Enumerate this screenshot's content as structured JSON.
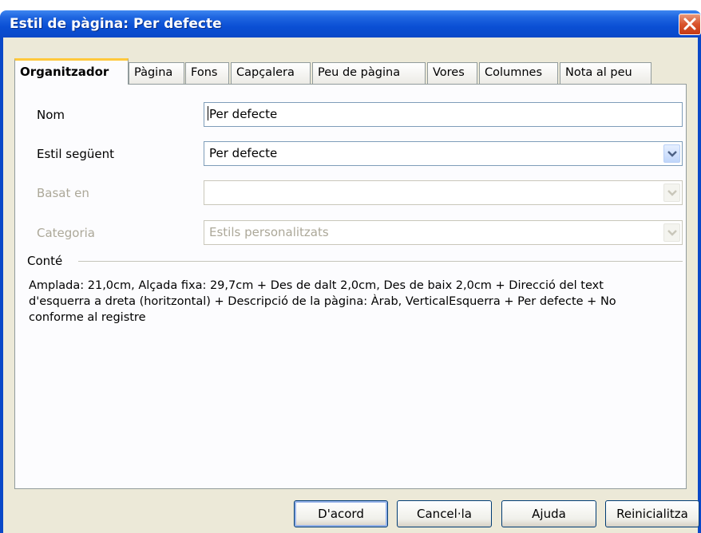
{
  "window": {
    "title": "Estil de pàgina: Per defecte"
  },
  "tabs": [
    {
      "label": "Organitzador"
    },
    {
      "label": "Pàgina"
    },
    {
      "label": "Fons"
    },
    {
      "label": "Capçalera"
    },
    {
      "label": "Peu de pàgina"
    },
    {
      "label": "Vores"
    },
    {
      "label": "Columnes"
    },
    {
      "label": "Nota al peu"
    }
  ],
  "form": {
    "name_label": "Nom",
    "name_value": "Per defecte",
    "next_style_label": "Estil següent",
    "next_style_value": "Per defecte",
    "linked_with_label": "Basat en",
    "linked_with_value": "",
    "category_label": "Categoria",
    "category_value": "Estils personalitzats"
  },
  "contains": {
    "heading": "Conté",
    "text": "Amplada: 21,0cm, Alçada fixa: 29,7cm + Des de dalt 2,0cm, Des de baix 2,0cm + Direcció del text d'esquerra a dreta (horitzontal) + Descripció de la pàgina: Àrab, VerticalEsquerra + Per defecte + No conforme al registre"
  },
  "buttons": {
    "ok": "D'acord",
    "cancel": "Cancel·la",
    "help": "Ajuda",
    "reset": "Reinicialitza"
  }
}
